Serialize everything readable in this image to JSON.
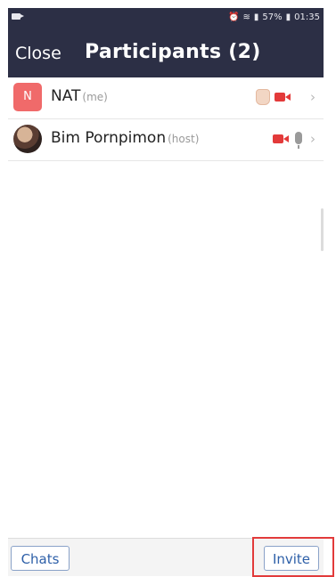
{
  "status_bar": {
    "battery": "57%",
    "time": "01:35",
    "icons": [
      "video-camera-icon",
      "alarm-icon",
      "wifi-icon",
      "signal-icon",
      "battery-icon"
    ]
  },
  "header": {
    "close_label": "Close",
    "title": "Participants (2)"
  },
  "participants": [
    {
      "initial": "N",
      "name": "NAT",
      "tag": "(me)",
      "icons": [
        "raised-hand-icon",
        "video-off-icon",
        "chevron-right-icon"
      ]
    },
    {
      "name": "Bim Pornpimon",
      "tag": "(host)",
      "icons": [
        "video-off-icon",
        "microphone-icon",
        "chevron-right-icon"
      ]
    }
  ],
  "footer": {
    "chats_label": "Chats",
    "invite_label": "Invite"
  },
  "colors": {
    "header_bg": "#2c2f45",
    "avatar_bg": "#f06a6a",
    "button_text": "#2d5fa8",
    "video_off": "#e33a3a",
    "annotation": "#e23b3b"
  }
}
